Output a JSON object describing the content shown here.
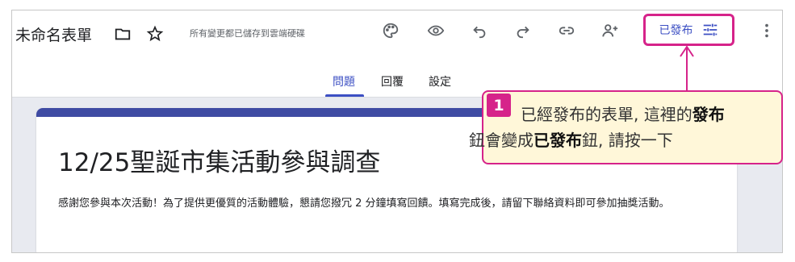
{
  "header": {
    "form_title": "未命名表單",
    "saved_status": "所有變更都已儲存到雲端硬碟",
    "published_label": "已發布",
    "icons": [
      "folder-icon",
      "star-icon",
      "palette-icon",
      "eye-icon",
      "undo-icon",
      "redo-icon",
      "link-icon",
      "add-person-icon",
      "tune-icon",
      "more-vert-icon"
    ]
  },
  "tabs": [
    {
      "label": "問題",
      "active": true
    },
    {
      "label": "回覆",
      "active": false
    },
    {
      "label": "設定",
      "active": false
    }
  ],
  "form": {
    "title": "12/25聖誕市集活動參與調查",
    "description": "感謝您參與本次活動！為了提供更優質的活動體驗，懇請您撥冗 2 分鐘填寫回饋。填寫完成後，請留下聯絡資料即可參加抽獎活動。"
  },
  "callout": {
    "number": "1",
    "text_1": "已經發布的表單, 這裡的",
    "bold_1": "發布",
    "text_2": "鈕會變成",
    "bold_2": "已發布",
    "text_3": "鈕, 請按一下"
  },
  "colors": {
    "accent": "#3c4fc3",
    "highlight": "#d6238a",
    "callout_bg": "#fff7d9",
    "header_band": "#3f4ba3"
  }
}
